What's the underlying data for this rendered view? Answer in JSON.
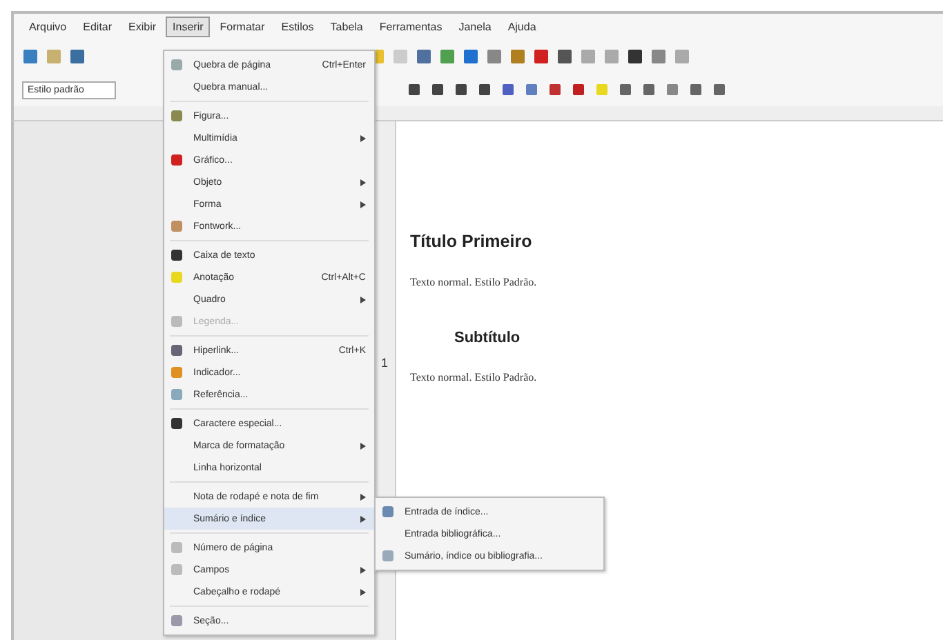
{
  "menu_bar": [
    {
      "label": "Arquivo",
      "selected": false
    },
    {
      "label": "Editar",
      "selected": false
    },
    {
      "label": "Exibir",
      "selected": false
    },
    {
      "label": "Inserir",
      "selected": true
    },
    {
      "label": "Formatar",
      "selected": false
    },
    {
      "label": "Estilos",
      "selected": false
    },
    {
      "label": "Tabela",
      "selected": false
    },
    {
      "label": "Ferramentas",
      "selected": false
    },
    {
      "label": "Janela",
      "selected": false
    },
    {
      "label": "Ajuda",
      "selected": false
    }
  ],
  "formatting_toolbar": {
    "paragraph_style": "Estilo padrão"
  },
  "insert_menu": [
    {
      "kind": "item",
      "label": "Quebra de página",
      "shortcut": "Ctrl+Enter",
      "submenu": false,
      "disabled": false,
      "selected": false
    },
    {
      "kind": "item",
      "label": "Quebra manual...",
      "submenu": false,
      "disabled": false,
      "selected": false
    },
    {
      "kind": "separator"
    },
    {
      "kind": "item",
      "label": "Figura...",
      "submenu": false,
      "disabled": false,
      "selected": false
    },
    {
      "kind": "item",
      "label": "Multimídia",
      "submenu": true,
      "disabled": false,
      "selected": false
    },
    {
      "kind": "item",
      "label": "Gráfico...",
      "submenu": false,
      "disabled": false,
      "selected": false
    },
    {
      "kind": "item",
      "label": "Objeto",
      "submenu": true,
      "disabled": false,
      "selected": false
    },
    {
      "kind": "item",
      "label": "Forma",
      "submenu": true,
      "disabled": false,
      "selected": false
    },
    {
      "kind": "item",
      "label": "Fontwork...",
      "submenu": false,
      "disabled": false,
      "selected": false
    },
    {
      "kind": "separator"
    },
    {
      "kind": "item",
      "label": "Caixa de texto",
      "submenu": false,
      "disabled": false,
      "selected": false
    },
    {
      "kind": "item",
      "label": "Anotação",
      "shortcut": "Ctrl+Alt+C",
      "submenu": false,
      "disabled": false,
      "selected": false
    },
    {
      "kind": "item",
      "label": "Quadro",
      "submenu": true,
      "disabled": false,
      "selected": false
    },
    {
      "kind": "item",
      "label": "Legenda...",
      "submenu": false,
      "disabled": true,
      "selected": false
    },
    {
      "kind": "separator"
    },
    {
      "kind": "item",
      "label": "Hiperlink...",
      "shortcut": "Ctrl+K",
      "submenu": false,
      "disabled": false,
      "selected": false
    },
    {
      "kind": "item",
      "label": "Indicador...",
      "submenu": false,
      "disabled": false,
      "selected": false
    },
    {
      "kind": "item",
      "label": "Referência...",
      "submenu": false,
      "disabled": false,
      "selected": false
    },
    {
      "kind": "separator"
    },
    {
      "kind": "item",
      "label": "Caractere especial...",
      "submenu": false,
      "disabled": false,
      "selected": false
    },
    {
      "kind": "item",
      "label": "Marca de formatação",
      "submenu": true,
      "disabled": false,
      "selected": false
    },
    {
      "kind": "item",
      "label": "Linha horizontal",
      "submenu": false,
      "disabled": false,
      "selected": false
    },
    {
      "kind": "separator"
    },
    {
      "kind": "item",
      "label": "Nota de rodapé e nota de fim",
      "submenu": true,
      "disabled": false,
      "selected": false
    },
    {
      "kind": "item",
      "label": "Sumário e índice",
      "submenu": true,
      "disabled": false,
      "selected": true
    },
    {
      "kind": "separator"
    },
    {
      "kind": "item",
      "label": "Número de página",
      "submenu": false,
      "disabled": false,
      "selected": false
    },
    {
      "kind": "item",
      "label": "Campos",
      "submenu": true,
      "disabled": false,
      "selected": false
    },
    {
      "kind": "item",
      "label": "Cabeçalho e rodapé",
      "submenu": true,
      "disabled": false,
      "selected": false
    },
    {
      "kind": "separator"
    },
    {
      "kind": "item",
      "label": "Seção...",
      "submenu": false,
      "disabled": false,
      "selected": false
    }
  ],
  "index_submenu": [
    {
      "label": "Entrada de índice..."
    },
    {
      "label": "Entrada bibliográfica..."
    },
    {
      "label": "Sumário, índice ou bibliografia..."
    }
  ],
  "vertical_ruler": {
    "mark": "1"
  },
  "document": [
    {
      "kind": "heading1",
      "text": "Título Primeiro"
    },
    {
      "kind": "body",
      "text": "Texto normal. Estilo Padrão."
    },
    {
      "kind": "heading2",
      "text": "Subtítulo"
    },
    {
      "kind": "body",
      "text": "Texto normal. Estilo Padrão."
    }
  ]
}
